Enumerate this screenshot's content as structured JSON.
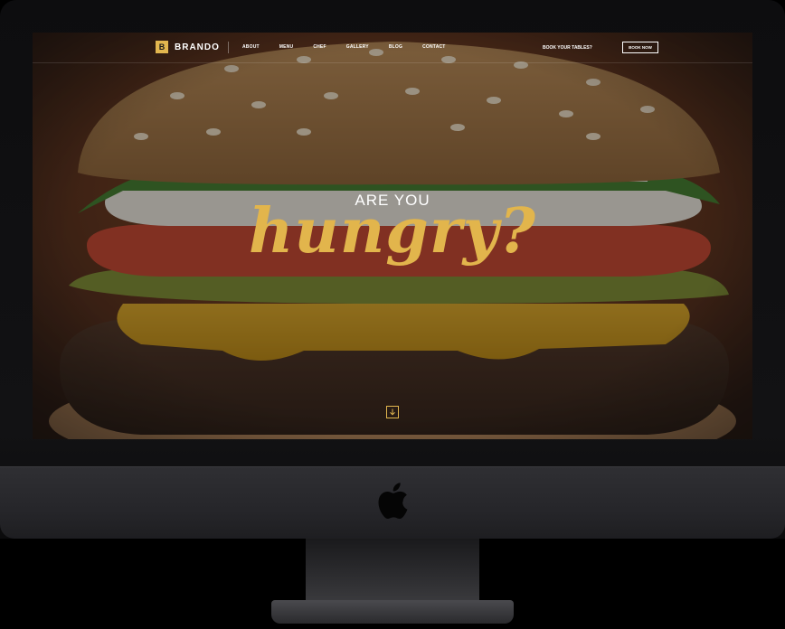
{
  "brand": {
    "mark": "B",
    "name": "BRANDO"
  },
  "nav": {
    "items": [
      "ABOUT",
      "MENU",
      "CHEF",
      "GALLERY",
      "BLOG",
      "CONTACT"
    ],
    "book_label": "BOOK YOUR TABLES?",
    "book_button": "BOOK NOW"
  },
  "hero": {
    "eyebrow": "ARE YOU",
    "title": "hungry?",
    "scroll_icon": "arrow-down-icon"
  },
  "colors": {
    "accent": "#e1b64f",
    "nav_text": "#ffffff",
    "bezel": "#0f0f10",
    "chin": "#2a2a2e"
  }
}
